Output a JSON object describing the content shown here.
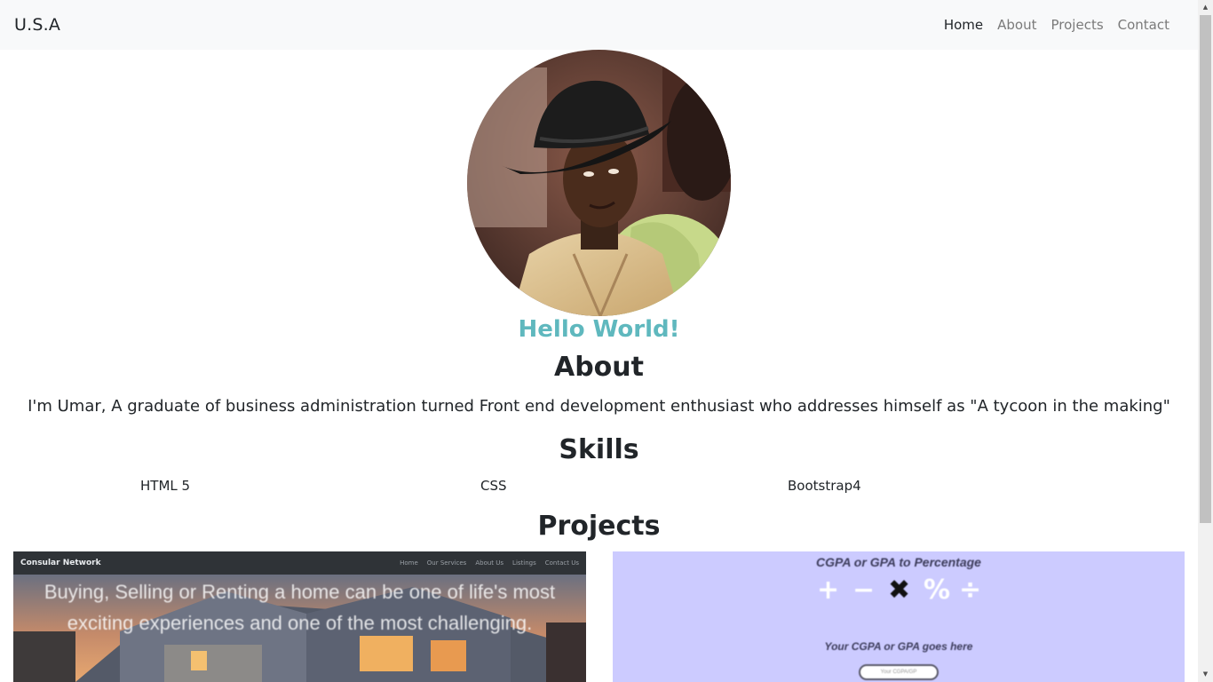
{
  "navbar": {
    "brand": "U.S.A",
    "links": [
      {
        "label": "Home",
        "active": true
      },
      {
        "label": "About",
        "active": false
      },
      {
        "label": "Projects",
        "active": false
      },
      {
        "label": "Contact",
        "active": false
      }
    ]
  },
  "hero": {
    "greeting": "Hello World!"
  },
  "about": {
    "title": "About",
    "text": "I'm Umar, A graduate of business administration turned Front end development enthusiast who addresses himself as \"A tycoon in the making\""
  },
  "skills": {
    "title": "Skills",
    "items": [
      "HTML 5",
      "CSS",
      "Bootstrap4"
    ]
  },
  "projects": {
    "title": "Projects",
    "cards": [
      {
        "brand": "Consular Network",
        "links": [
          "Home",
          "Our Services",
          "About Us",
          "Listings",
          "Contact Us"
        ],
        "headline": "Buying, Selling or Renting a home can be one of life's most exciting experiences and one of the most challenging."
      },
      {
        "title": "CGPA or GPA to Percentage",
        "operators": [
          "+",
          "−",
          "✖",
          "%",
          "÷"
        ],
        "subtitle": "Your CGPA or GPA goes here",
        "input_placeholder": "Your CGPA/GP"
      }
    ]
  },
  "colors": {
    "navbar_bg": "#f8f9fa",
    "accent": "#5fb8be",
    "text": "#212529",
    "nav_inactive": "#7a7a7a",
    "calc_bg": "#cccbff"
  }
}
